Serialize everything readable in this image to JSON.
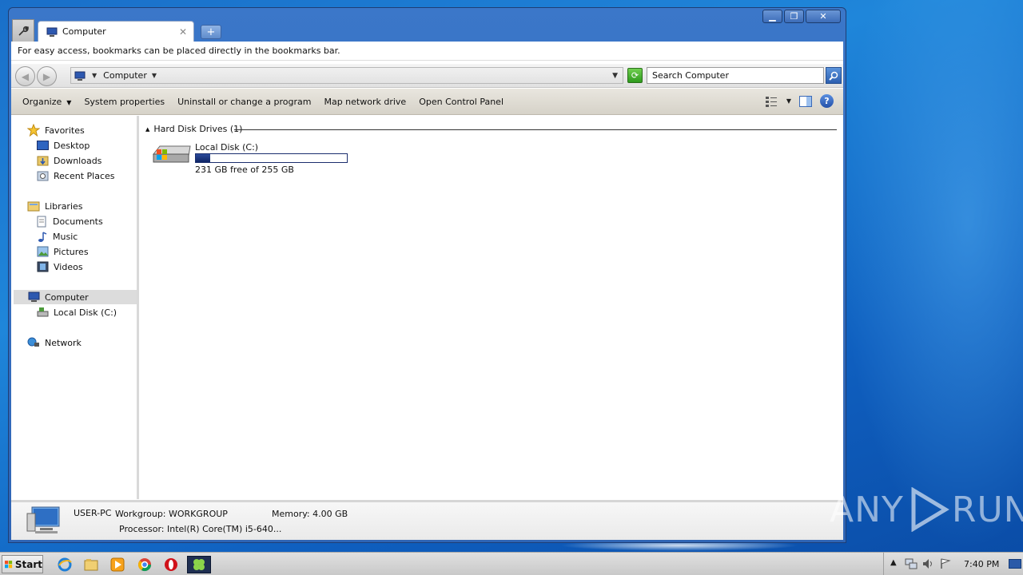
{
  "window": {
    "tab_title": "Computer",
    "new_tab_symbol": "+",
    "close_tab_symbol": "✕"
  },
  "bookmark_bar": {
    "text": "For easy access, bookmarks can be placed directly in the bookmarks bar."
  },
  "address": {
    "location": "Computer",
    "search_placeholder": "Search Computer"
  },
  "toolbar": {
    "organize": "Organize",
    "system_properties": "System properties",
    "uninstall": "Uninstall or change a program",
    "map_network_drive": "Map network drive",
    "open_control_panel": "Open Control Panel"
  },
  "sidebar": {
    "favorites": "Favorites",
    "desktop": "Desktop",
    "downloads": "Downloads",
    "recent_places": "Recent Places",
    "libraries": "Libraries",
    "documents": "Documents",
    "music": "Music",
    "pictures": "Pictures",
    "videos": "Videos",
    "computer": "Computer",
    "local_disk": "Local Disk (C:)",
    "network": "Network"
  },
  "main": {
    "group_header": "Hard Disk Drives (1)",
    "drive_name": "Local Disk (C:)",
    "drive_free": "231 GB free of 255 GB",
    "drive_used_fraction": 0.094
  },
  "details": {
    "pc_name": "USER-PC",
    "workgroup": "Workgroup: WORKGROUP",
    "memory": "Memory: 4.00 GB",
    "processor": "Processor: Intel(R) Core(TM) i5-640..."
  },
  "taskbar": {
    "start_label": "Start",
    "clock": "7:40 PM"
  },
  "watermark": {
    "left": "ANY",
    "right": "RUN"
  },
  "icons": {
    "wrench": "wrench-icon",
    "search": "magnifier-icon",
    "refresh": "refresh-icon",
    "help": "help-icon"
  },
  "colors": {
    "desktop_blue": "#1f86da",
    "window_frame": "#3b77c9",
    "drive_bar": "#0f2566"
  }
}
